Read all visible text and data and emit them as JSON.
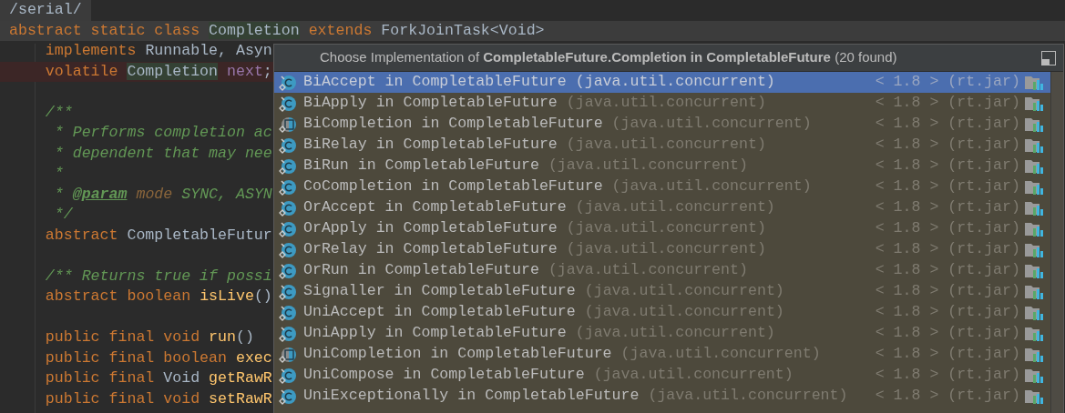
{
  "breadcrumb": "/serial/",
  "code_lines": [
    {
      "kind": "code",
      "current": true,
      "segments": [
        {
          "kind": "keyword",
          "text": "abstract static class "
        },
        {
          "kind": "usage",
          "text": "Completion"
        },
        {
          "kind": "keyword",
          "text": " extends"
        },
        {
          "kind": "plain",
          "text": " ForkJoinTask<Void>"
        }
      ]
    },
    {
      "kind": "code",
      "segments": [
        {
          "kind": "keyword",
          "text": "    implements"
        },
        {
          "kind": "plain",
          "text": " Runnable, Asyn"
        }
      ]
    },
    {
      "kind": "code",
      "error": true,
      "segments": [
        {
          "kind": "keyword",
          "text": "    volatile "
        },
        {
          "kind": "usage",
          "text": "Completion"
        },
        {
          "kind": "field",
          "text": " next"
        },
        {
          "kind": "plain",
          "text": ";"
        }
      ]
    },
    {
      "kind": "blank"
    },
    {
      "kind": "code",
      "segments": [
        {
          "kind": "comment",
          "text": "    /**"
        }
      ]
    },
    {
      "kind": "code",
      "segments": [
        {
          "kind": "comment",
          "text": "     * Performs completion ac"
        }
      ]
    },
    {
      "kind": "code",
      "segments": [
        {
          "kind": "comment",
          "text": "     * dependent that may nee"
        }
      ]
    },
    {
      "kind": "code",
      "segments": [
        {
          "kind": "comment",
          "text": "     *"
        }
      ]
    },
    {
      "kind": "code",
      "segments": [
        {
          "kind": "comment",
          "text": "     * "
        },
        {
          "kind": "doc_tag",
          "text": "@param"
        },
        {
          "kind": "doc_param",
          "text": " mode"
        },
        {
          "kind": "comment",
          "text": " SYNC, ASYN"
        }
      ]
    },
    {
      "kind": "code",
      "segments": [
        {
          "kind": "comment",
          "text": "     */"
        }
      ]
    },
    {
      "kind": "code",
      "segments": [
        {
          "kind": "keyword",
          "text": "    abstract"
        },
        {
          "kind": "plain",
          "text": " CompletableFutur"
        }
      ]
    },
    {
      "kind": "blank"
    },
    {
      "kind": "code",
      "segments": [
        {
          "kind": "comment",
          "text": "    /** Returns true if possi"
        }
      ]
    },
    {
      "kind": "code",
      "segments": [
        {
          "kind": "keyword",
          "text": "    abstract boolean "
        },
        {
          "kind": "method",
          "text": "isLive"
        },
        {
          "kind": "plain",
          "text": "()"
        }
      ]
    },
    {
      "kind": "blank"
    },
    {
      "kind": "code",
      "segments": [
        {
          "kind": "keyword",
          "text": "    public final void "
        },
        {
          "kind": "method",
          "text": "run"
        },
        {
          "kind": "plain",
          "text": "()"
        }
      ]
    },
    {
      "kind": "code",
      "segments": [
        {
          "kind": "keyword",
          "text": "    public final boolean "
        },
        {
          "kind": "method",
          "text": "exec"
        }
      ]
    },
    {
      "kind": "code",
      "segments": [
        {
          "kind": "keyword",
          "text": "    public final "
        },
        {
          "kind": "plain",
          "text": "Void "
        },
        {
          "kind": "method",
          "text": "getRawR"
        }
      ]
    },
    {
      "kind": "code",
      "segments": [
        {
          "kind": "keyword",
          "text": "    public final void "
        },
        {
          "kind": "method",
          "text": "setRawR"
        }
      ]
    }
  ],
  "popup": {
    "title": "Choose Implementation of **CompletableFuture.Completion in CompletableFuture** (20 found)",
    "items": [
      {
        "kind": "class",
        "selected": true,
        "name": "BiAccept in CompletableFuture",
        "package": "(java.util.concurrent)",
        "library": "< 1.8 > (rt.jar)"
      },
      {
        "kind": "class",
        "selected": false,
        "name": "BiApply in CompletableFuture",
        "package": "(java.util.concurrent)",
        "library": "< 1.8 > (rt.jar)"
      },
      {
        "kind": "abstract_class",
        "selected": false,
        "name": "BiCompletion in CompletableFuture",
        "package": "(java.util.concurrent)",
        "library": "< 1.8 > (rt.jar)"
      },
      {
        "kind": "class",
        "selected": false,
        "name": "BiRelay in CompletableFuture",
        "package": "(java.util.concurrent)",
        "library": "< 1.8 > (rt.jar)"
      },
      {
        "kind": "class",
        "selected": false,
        "name": "BiRun in CompletableFuture",
        "package": "(java.util.concurrent)",
        "library": "< 1.8 > (rt.jar)"
      },
      {
        "kind": "class",
        "selected": false,
        "name": "CoCompletion in CompletableFuture",
        "package": "(java.util.concurrent)",
        "library": "< 1.8 > (rt.jar)"
      },
      {
        "kind": "class",
        "selected": false,
        "name": "OrAccept in CompletableFuture",
        "package": "(java.util.concurrent)",
        "library": "< 1.8 > (rt.jar)"
      },
      {
        "kind": "class",
        "selected": false,
        "name": "OrApply in CompletableFuture",
        "package": "(java.util.concurrent)",
        "library": "< 1.8 > (rt.jar)"
      },
      {
        "kind": "class",
        "selected": false,
        "name": "OrRelay in CompletableFuture",
        "package": "(java.util.concurrent)",
        "library": "< 1.8 > (rt.jar)"
      },
      {
        "kind": "class",
        "selected": false,
        "name": "OrRun in CompletableFuture",
        "package": "(java.util.concurrent)",
        "library": "< 1.8 > (rt.jar)"
      },
      {
        "kind": "class",
        "selected": false,
        "name": "Signaller in CompletableFuture",
        "package": "(java.util.concurrent)",
        "library": "< 1.8 > (rt.jar)"
      },
      {
        "kind": "class",
        "selected": false,
        "name": "UniAccept in CompletableFuture",
        "package": "(java.util.concurrent)",
        "library": "< 1.8 > (rt.jar)"
      },
      {
        "kind": "class",
        "selected": false,
        "name": "UniApply in CompletableFuture",
        "package": "(java.util.concurrent)",
        "library": "< 1.8 > (rt.jar)"
      },
      {
        "kind": "abstract_class",
        "selected": false,
        "name": "UniCompletion in CompletableFuture",
        "package": "(java.util.concurrent)",
        "library": "< 1.8 > (rt.jar)"
      },
      {
        "kind": "class",
        "selected": false,
        "name": "UniCompose in CompletableFuture",
        "package": "(java.util.concurrent)",
        "library": "< 1.8 > (rt.jar)"
      },
      {
        "kind": "class",
        "selected": false,
        "name": "UniExceptionally in CompletableFuture",
        "package": "(java.util.concurrent)",
        "library": "< 1.8 > (rt.jar)"
      }
    ]
  }
}
